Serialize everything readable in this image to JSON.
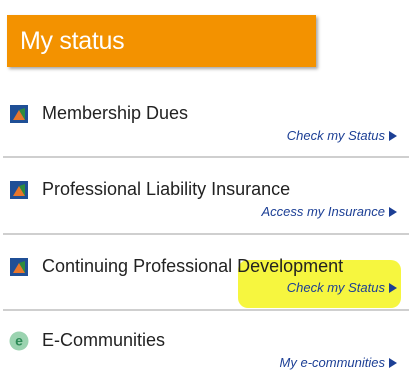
{
  "header": {
    "title": "My status"
  },
  "items": [
    {
      "label": "Membership Dues",
      "link": "Check my Status",
      "icon": "report-icon"
    },
    {
      "label": "Professional Liability Insurance",
      "link": "Access my Insurance",
      "icon": "report-icon"
    },
    {
      "label": "Continuing Professional Development",
      "link": "Check my Status",
      "icon": "report-icon"
    },
    {
      "label": "E-Communities",
      "link": "My e-communities",
      "icon": "e-communities-icon"
    }
  ],
  "colors": {
    "header": "#f39200",
    "link": "#1c3f95",
    "highlight": "#f5f52a"
  }
}
